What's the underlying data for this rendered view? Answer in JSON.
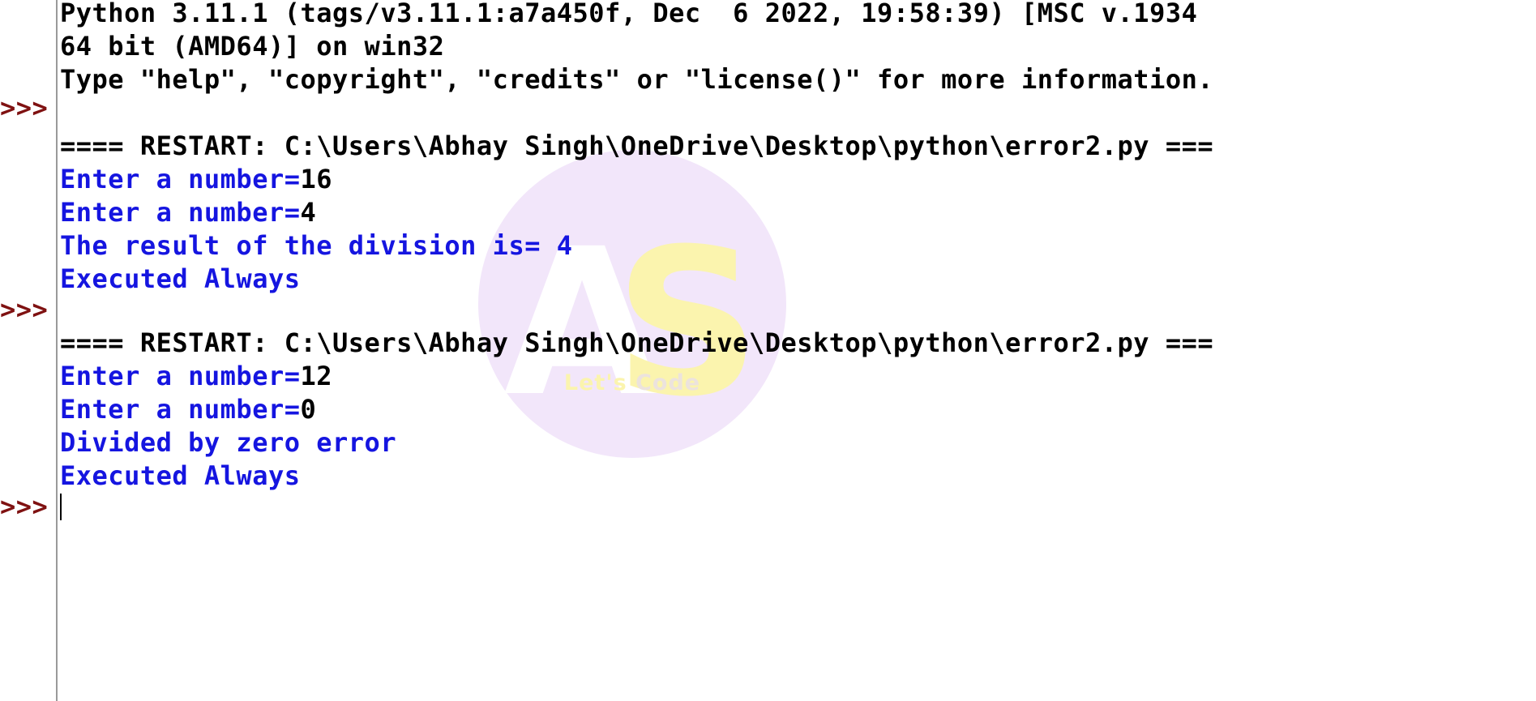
{
  "window": {
    "title": "Python 3.11.1 Shell",
    "background_color": "#ffffff",
    "prompt_color": "#7f1111",
    "output_color": "#1515e0",
    "stdin_color": "#000000"
  },
  "watermark": {
    "initial_a": "A",
    "initial_s": "S",
    "tagline_first": "Let's",
    "tagline_second": "Code",
    "circle_color": "#f2e6fa",
    "a_color": "#ffffff",
    "s_color": "#fbf4ae"
  },
  "banner": {
    "line1": "Python 3.11.1 (tags/v3.11.1:a7a450f, Dec  6 2022, 19:58:39) [MSC v.1934",
    "line2": "64 bit (AMD64)] on win32",
    "line3": "Type \"help\", \"copyright\", \"credits\" or \"license()\" for more information."
  },
  "prompts": {
    "p1": ">>>",
    "p2": ">>>",
    "p3": ">>>"
  },
  "run1": {
    "restart": "==== RESTART: C:\\Users\\Abhay Singh\\OneDrive\\Desktop\\python\\error2.py ===",
    "l1_label": "Enter a number=",
    "l1_value": "16",
    "l2_label": "Enter a number=",
    "l2_value": "4",
    "l3": "The result of the division is= 4",
    "l4": "Executed Always"
  },
  "run2": {
    "restart": "==== RESTART: C:\\Users\\Abhay Singh\\OneDrive\\Desktop\\python\\error2.py ===",
    "l1_label": "Enter a number=",
    "l1_value": "12",
    "l2_label": "Enter a number=",
    "l2_value": "0",
    "l3": "Divided by zero error",
    "l4": "Executed Always"
  }
}
